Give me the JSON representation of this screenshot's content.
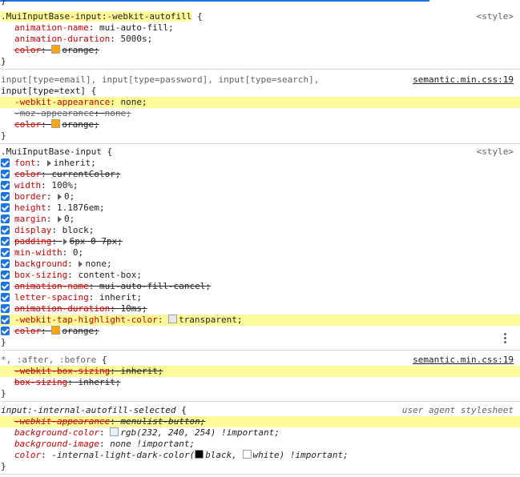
{
  "rules": [
    {
      "selector": ".MuiInputBase-input:-webkit-autofill",
      "selector_hl": true,
      "source": "<style>",
      "source_kind": "plain",
      "open": " {",
      "decls": [
        {
          "prop": "animation-name",
          "val": "mui-auto-fill;",
          "strike": false,
          "hl": false
        },
        {
          "prop": "animation-duration",
          "val": "5000s;",
          "strike": false,
          "hl": false
        },
        {
          "prop": "color",
          "val": "orange;",
          "strike": true,
          "hl": false,
          "swatch": "#ffa500"
        }
      ]
    },
    {
      "selector_line1": "input[type=email], input[type=password], input[type=search],",
      "selector": "input[type=text]",
      "source": "semantic.min.css:19",
      "source_kind": "link",
      "open": " {",
      "decls": [
        {
          "prop": "-webkit-appearance",
          "val": "none;",
          "strike": false,
          "hl": true
        },
        {
          "prop": "-moz-appearance",
          "val": "none;",
          "strike": true,
          "hl": false,
          "dim": true
        },
        {
          "prop": "color",
          "val": "orange;",
          "strike": true,
          "hl": false,
          "swatch": "#ffa500"
        }
      ]
    },
    {
      "selector": ".MuiInputBase-input",
      "source": "<style>",
      "source_kind": "plain",
      "open": " {",
      "checkboxes": true,
      "decls": [
        {
          "prop": "font",
          "val": "inherit;",
          "expand": true
        },
        {
          "prop": "color",
          "val": "currentColor;",
          "strike": true
        },
        {
          "prop": "width",
          "val": "100%;"
        },
        {
          "prop": "border",
          "val": "0;",
          "expand": true
        },
        {
          "prop": "height",
          "val": "1.1876em;"
        },
        {
          "prop": "margin",
          "val": "0;",
          "expand": true
        },
        {
          "prop": "display",
          "val": "block;"
        },
        {
          "prop": "padding",
          "val": "6px 0 7px;",
          "strike": true,
          "expand": true
        },
        {
          "prop": "min-width",
          "val": "0;"
        },
        {
          "prop": "background",
          "val": "none;",
          "expand": true
        },
        {
          "prop": "box-sizing",
          "val": "content-box;"
        },
        {
          "prop": "animation-name",
          "val": "mui-auto-fill-cancel;",
          "strike": true
        },
        {
          "prop": "letter-spacing",
          "val": "inherit;"
        },
        {
          "prop": "animation-duration",
          "val": "10ms;",
          "strike": true
        },
        {
          "prop": "-webkit-tap-highlight-color",
          "val": "transparent;",
          "hl": true,
          "swatch": "#e8e8e8"
        },
        {
          "prop": "color",
          "val": "orange;",
          "strike": true,
          "swatch": "#ffa500"
        }
      ]
    },
    {
      "selector": "*, :after, :before",
      "selector_dim": true,
      "source": "semantic.min.css:19",
      "source_kind": "link",
      "open": " {",
      "decls": [
        {
          "prop": "-webkit-box-sizing",
          "val": "inherit;",
          "strike": true,
          "hl": true
        },
        {
          "prop": "box-sizing",
          "val": "inherit;",
          "strike": true
        }
      ]
    },
    {
      "selector": "input:-internal-autofill-selected",
      "source": "user agent stylesheet",
      "source_kind": "ital",
      "open": " {",
      "italic": true,
      "decls": [
        {
          "prop": "-webkit-appearance",
          "val": "menulist-button;",
          "strike": true,
          "hl": true
        },
        {
          "prop": "background-color",
          "val": "rgb(232, 240, 254) !important;",
          "swatch": "#e8f0fe"
        },
        {
          "prop": "background-image",
          "val": "none !important;"
        },
        {
          "prop": "color",
          "val_parts": [
            "-internal-light-dark-color(",
            "black, ",
            "white) !important;"
          ],
          "swatches": [
            "#000000",
            "#ffffff"
          ]
        }
      ]
    }
  ],
  "close_brace": "}",
  "top_brace": "}"
}
